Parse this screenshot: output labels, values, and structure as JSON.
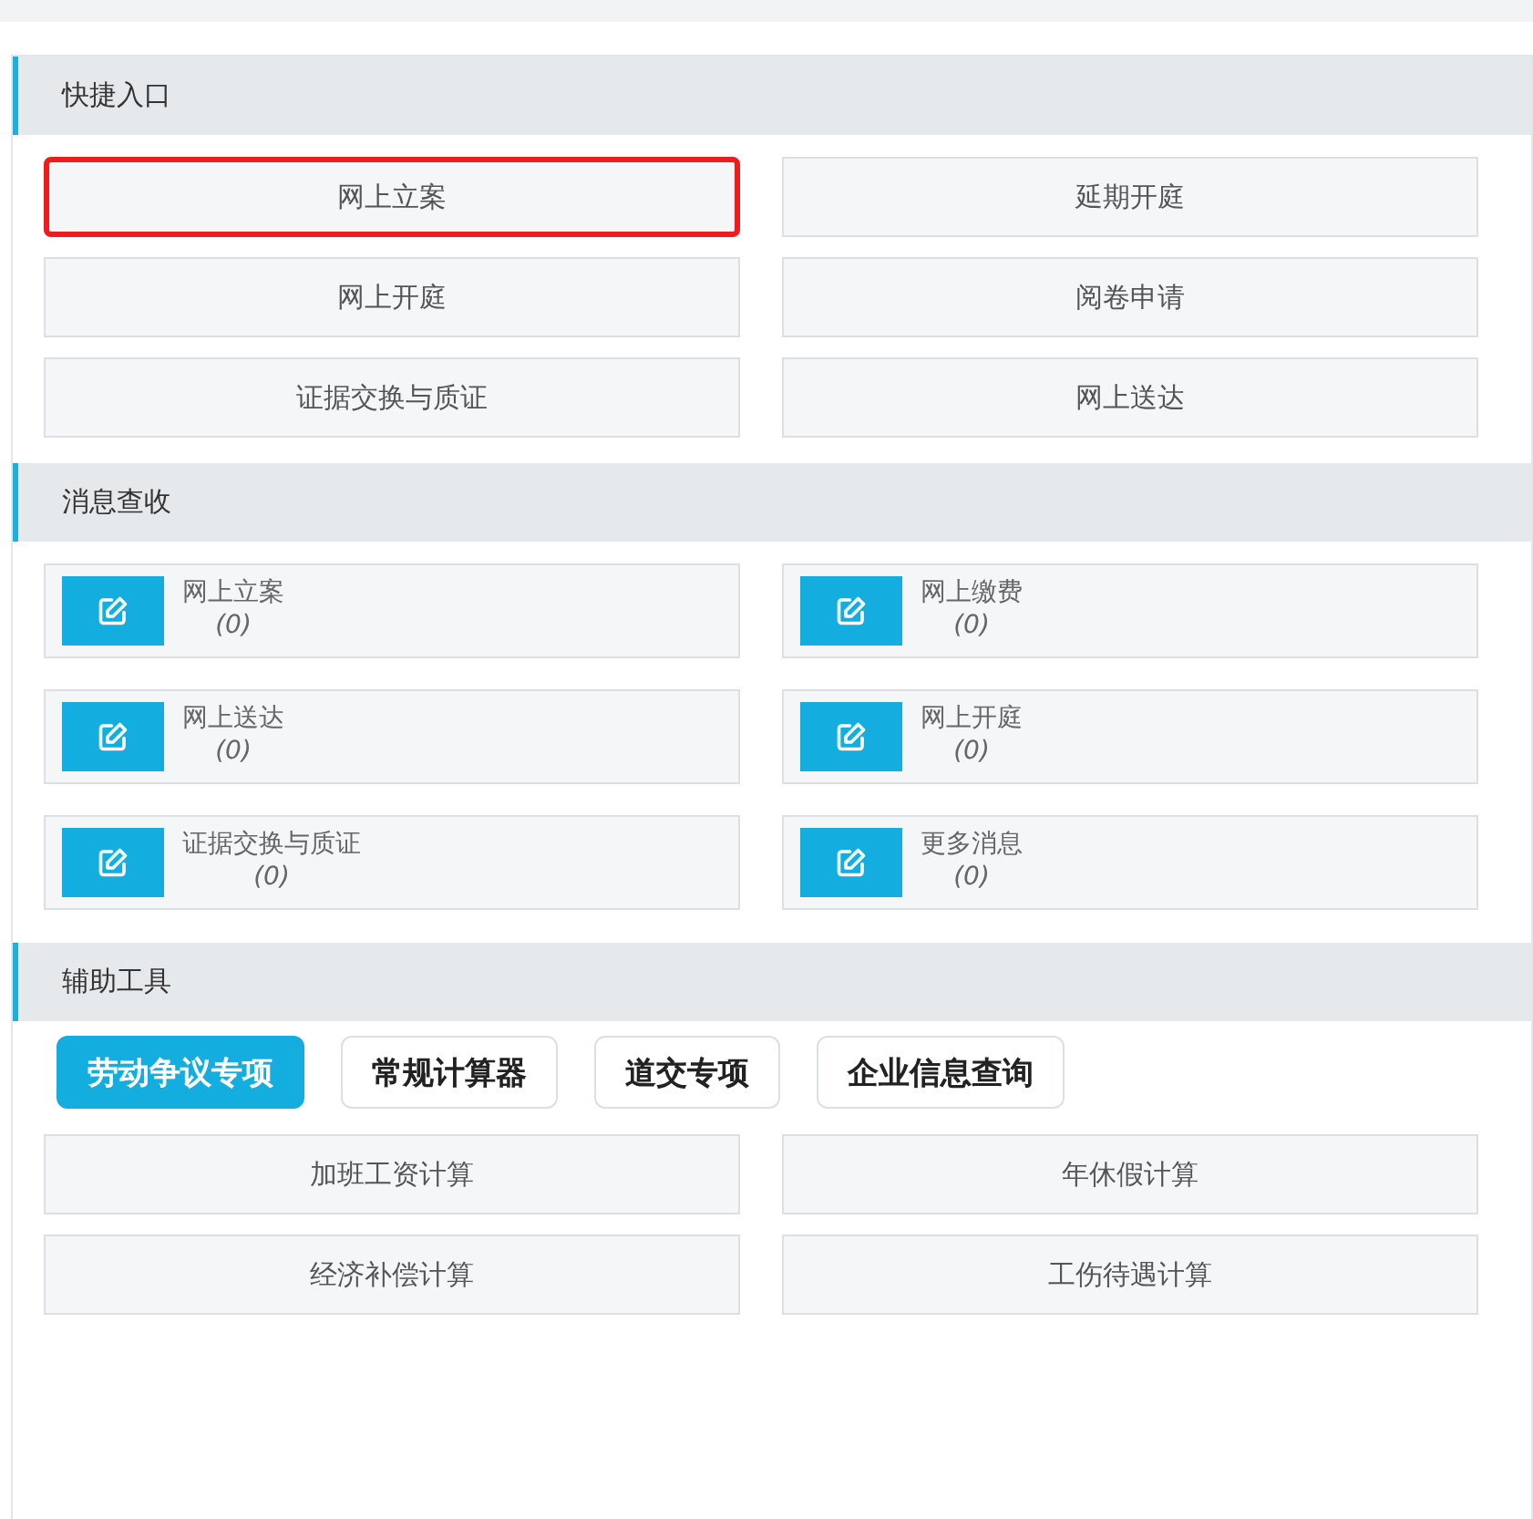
{
  "shortcuts": {
    "title": "快捷入口",
    "buttons": [
      {
        "label": "网上立案",
        "highlighted": true
      },
      {
        "label": "延期开庭",
        "highlighted": false
      },
      {
        "label": "网上开庭",
        "highlighted": false
      },
      {
        "label": "阅卷申请",
        "highlighted": false
      },
      {
        "label": "证据交换与质证",
        "highlighted": false
      },
      {
        "label": "网上送达",
        "highlighted": false
      }
    ]
  },
  "messages": {
    "title": "消息查收",
    "items": [
      {
        "label": "网上立案",
        "count": "(0)"
      },
      {
        "label": "网上缴费",
        "count": "(0)"
      },
      {
        "label": "网上送达",
        "count": "(0)"
      },
      {
        "label": "网上开庭",
        "count": "(0)"
      },
      {
        "label": "证据交换与质证",
        "count": "(0)"
      },
      {
        "label": "更多消息",
        "count": "(0)"
      }
    ]
  },
  "tools": {
    "title": "辅助工具",
    "tabs": [
      {
        "label": "劳动争议专项",
        "selected": true
      },
      {
        "label": "常规计算器",
        "selected": false
      },
      {
        "label": "道交专项",
        "selected": false
      },
      {
        "label": "企业信息查询",
        "selected": false
      }
    ],
    "buttons": [
      "加班工资计算",
      "年休假计算",
      "经济补偿计算",
      "工伤待遇计算"
    ]
  }
}
